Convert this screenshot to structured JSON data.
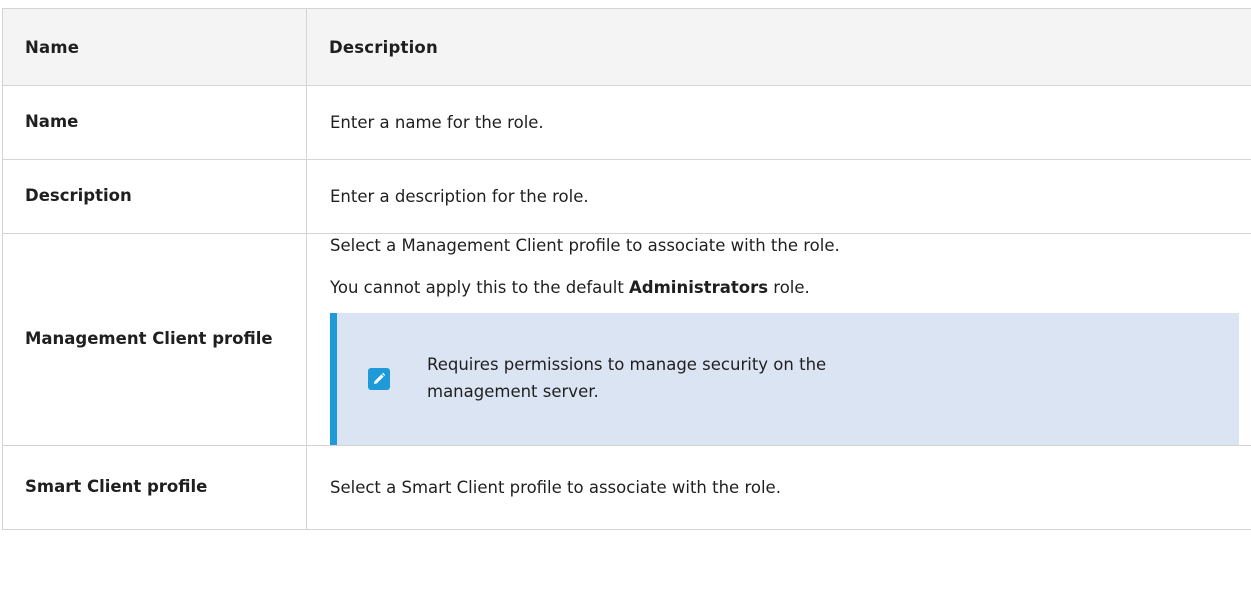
{
  "table": {
    "headers": {
      "name": "Name",
      "description": "Description"
    },
    "rows": [
      {
        "name": "Name",
        "description": "Enter a name for the role."
      },
      {
        "name": "Description",
        "description": "Enter a description for the role."
      },
      {
        "name": "Management Client profile",
        "description_line1": "Select a Management Client profile to associate with the role.",
        "description_line2_prefix": "You cannot apply this to the default ",
        "description_line2_bold": "Administrators",
        "description_line2_suffix": " role.",
        "note": {
          "icon": "pencil-note-icon",
          "text": "Requires permissions to manage security on the management server."
        }
      },
      {
        "name": "Smart Client profile",
        "description": "Select a Smart Client profile to associate with the role."
      }
    ]
  },
  "colors": {
    "header_bg": "#f4f4f4",
    "border": "#d4d4d4",
    "note_bg": "#dbe4f3",
    "note_accent": "#1f9ad9"
  }
}
